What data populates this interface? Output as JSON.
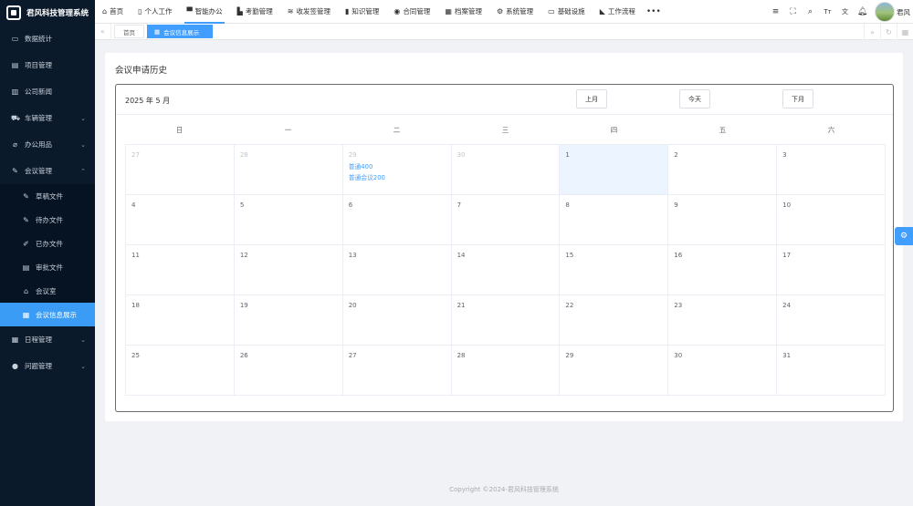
{
  "app": {
    "title": "君风科技管理系统"
  },
  "sidebar": {
    "items": [
      {
        "label": "数据统计",
        "icon": "chart-icon"
      },
      {
        "label": "项目管理",
        "icon": "file-icon"
      },
      {
        "label": "公司新闻",
        "icon": "news-icon"
      },
      {
        "label": "车辆管理",
        "icon": "car-icon",
        "expandable": true
      },
      {
        "label": "办公用品",
        "icon": "link-icon",
        "expandable": true
      },
      {
        "label": "会议管理",
        "icon": "tools-icon",
        "expandable": true,
        "expanded": true
      }
    ],
    "submenu": [
      {
        "label": "草稿文件",
        "icon": "edit-icon"
      },
      {
        "label": "待办文件",
        "icon": "edit-icon"
      },
      {
        "label": "已办文件",
        "icon": "pen-icon"
      },
      {
        "label": "审批文件",
        "icon": "doc-icon"
      },
      {
        "label": "会议室",
        "icon": "home-icon"
      },
      {
        "label": "会议信息展示",
        "icon": "calendar-icon",
        "active": true
      }
    ],
    "items_after": [
      {
        "label": "日程管理",
        "icon": "calendar-icon",
        "expandable": true
      },
      {
        "label": "问题管理",
        "icon": "bell-icon",
        "expandable": true
      }
    ]
  },
  "topnav": {
    "items": [
      {
        "label": "首页",
        "icon": "home-icon"
      },
      {
        "label": "个人工作",
        "icon": "cup-icon"
      },
      {
        "label": "智能办公",
        "icon": "user-icon",
        "active": true
      },
      {
        "label": "考勤管理",
        "icon": "bar-chart-icon"
      },
      {
        "label": "收发签管理",
        "icon": "stack-icon"
      },
      {
        "label": "知识管理",
        "icon": "book-icon"
      },
      {
        "label": "合同管理",
        "icon": "database-icon"
      },
      {
        "label": "档案管理",
        "icon": "grid-icon"
      },
      {
        "label": "系统管理",
        "icon": "gear-icon"
      },
      {
        "label": "基础设施",
        "icon": "monitor-icon"
      },
      {
        "label": "工作流程",
        "icon": "flow-icon"
      }
    ],
    "more": "•••"
  },
  "user": {
    "name": "君风"
  },
  "tags": {
    "home": "首页",
    "current": "会议信息展示"
  },
  "page": {
    "title": "会议申请历史"
  },
  "calendar": {
    "title": "2025 年 5 月",
    "prev_label": "上月",
    "today_label": "今天",
    "next_label": "下月",
    "weekdays": [
      "日",
      "一",
      "二",
      "三",
      "四",
      "五",
      "六"
    ],
    "days": [
      {
        "n": "27",
        "prev": true
      },
      {
        "n": "28",
        "prev": true
      },
      {
        "n": "29",
        "prev": true,
        "events": [
          "普通400",
          "普通会议200"
        ]
      },
      {
        "n": "30",
        "prev": true
      },
      {
        "n": "1",
        "today": true
      },
      {
        "n": "2"
      },
      {
        "n": "3"
      },
      {
        "n": "4"
      },
      {
        "n": "5"
      },
      {
        "n": "6"
      },
      {
        "n": "7"
      },
      {
        "n": "8"
      },
      {
        "n": "9"
      },
      {
        "n": "10"
      },
      {
        "n": "11"
      },
      {
        "n": "12"
      },
      {
        "n": "13"
      },
      {
        "n": "14"
      },
      {
        "n": "15"
      },
      {
        "n": "16"
      },
      {
        "n": "17"
      },
      {
        "n": "18"
      },
      {
        "n": "19"
      },
      {
        "n": "20"
      },
      {
        "n": "21"
      },
      {
        "n": "22"
      },
      {
        "n": "23"
      },
      {
        "n": "24"
      },
      {
        "n": "25"
      },
      {
        "n": "26"
      },
      {
        "n": "27"
      },
      {
        "n": "28"
      },
      {
        "n": "29"
      },
      {
        "n": "30"
      },
      {
        "n": "31"
      }
    ]
  },
  "footer": {
    "text": "Copyright ©2024-君风科技管理系统"
  }
}
